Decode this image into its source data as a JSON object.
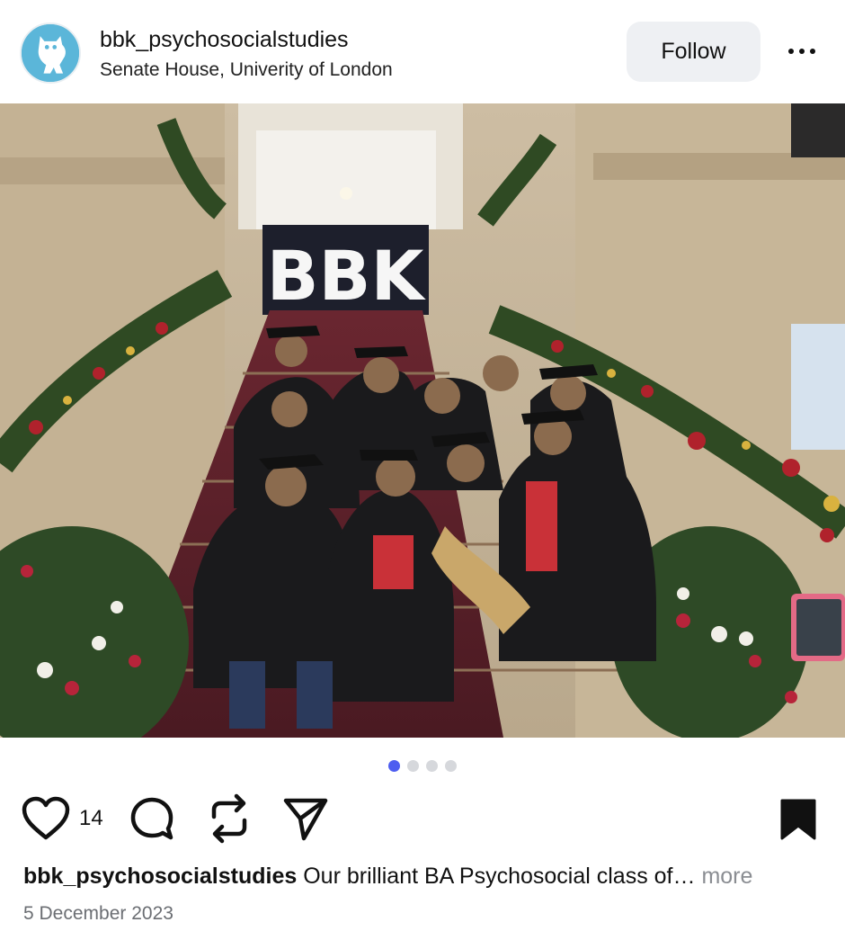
{
  "post": {
    "username": "bbk_psychosocialstudies",
    "location": "Senate House, Univerity of London",
    "follow_label": "Follow",
    "sign_text": "BBK",
    "carousel": {
      "count": 4,
      "active_index": 0,
      "active_color": "#4d5df0"
    },
    "likes": "14",
    "caption_user": "bbk_psychosocialstudies",
    "caption_text": " Our brilliant BA Psychosocial class of… ",
    "caption_more": "more",
    "date": "5 December 2023"
  },
  "icons": [
    "more-icon",
    "heart-icon",
    "comment-icon",
    "repost-icon",
    "share-icon",
    "bookmark-icon"
  ],
  "colors": {
    "accent": "#4d5df0",
    "avatar_bg": "#5bb6d9",
    "follow_bg": "#eef0f3",
    "muted_text": "#8a8d92"
  }
}
